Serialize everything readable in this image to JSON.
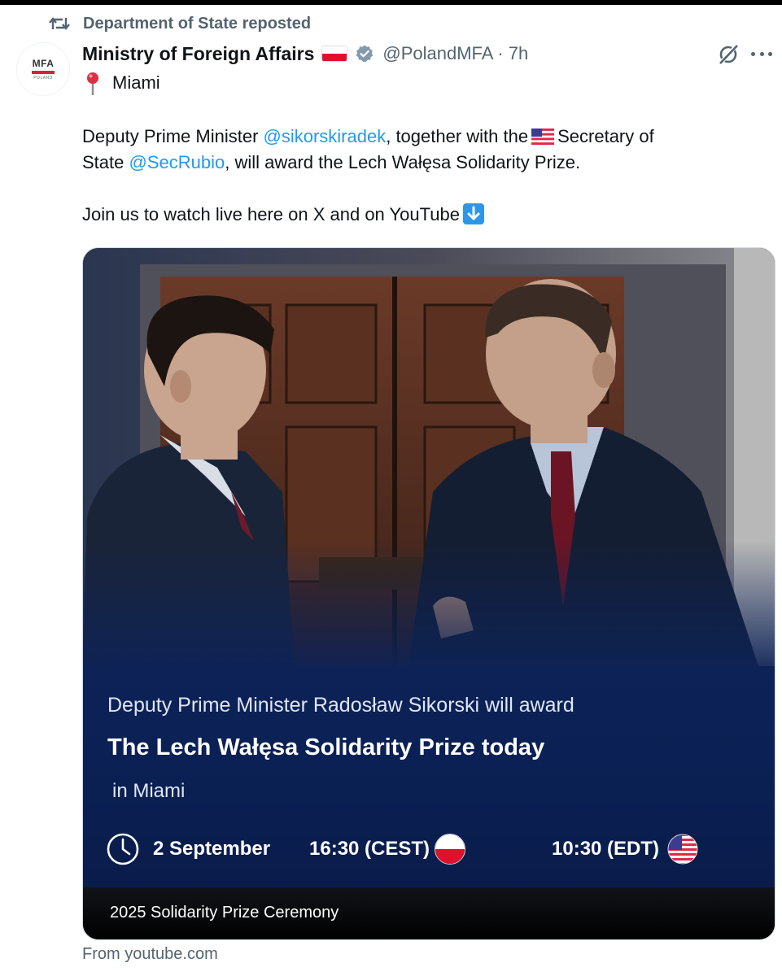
{
  "repost": {
    "text": "Department of State reposted"
  },
  "author": {
    "avatar_text": "MFA",
    "avatar_subtext": "POLAND",
    "name": "Ministry of Foreign Affairs",
    "handle_time": "@PolandMFA · 7h",
    "verified_color": "#829aab"
  },
  "icons": {
    "repost": "repost-icon",
    "grok": "grok-icon",
    "more": "more-icon",
    "pin": "round-pushpin-icon",
    "arrow": "down-arrow-icon",
    "clock": "clock-icon"
  },
  "location": "Miami",
  "tweet": {
    "p1_a": "Deputy Prime Minister ",
    "mention1": "@sikorskiradek",
    "p1_b": ", together with the",
    "p1_c": "Secretary of",
    "p2_a": "State ",
    "mention2": "@SecRubio",
    "p2_b": ", will award the Lech Wałęsa Solidarity Prize.",
    "p3": "Join us to watch live here on X and on YouTube"
  },
  "card": {
    "line1": "Deputy Prime Minister Radosław Sikorski will award",
    "line2": "The Lech Wałęsa Solidarity Prize today",
    "line3": "in Miami",
    "date": "2 September",
    "time_cest": "16:30 (CEST)",
    "time_edt": "10:30 (EDT)",
    "title": "2025 Solidarity Prize Ceremony"
  },
  "source": "From youtube.com",
  "colors": {
    "link": "#1d9bf0",
    "muted": "#536471",
    "banner": "#0d2358"
  }
}
